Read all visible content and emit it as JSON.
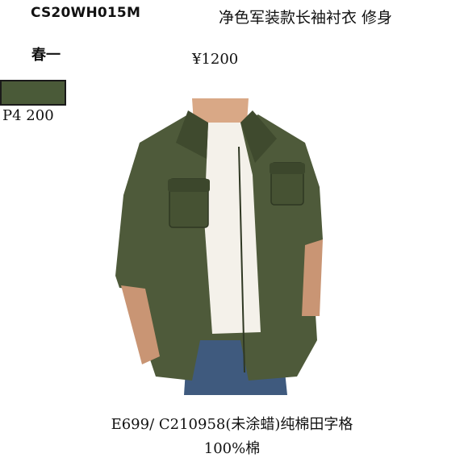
{
  "product": {
    "code": "CS20WH015M",
    "title": "净色军装款长袖衬衣 修身",
    "season": "春一",
    "price": "¥1200"
  },
  "swatch": {
    "color": "#4a5a38",
    "label": "P4 200"
  },
  "photo": {
    "subject": "olive-green-military-shirt",
    "shirt_color": "#4e5a3a",
    "tee_color": "#f4f1ea",
    "jeans_color": "#3f5a7e"
  },
  "footer": {
    "fabric": "E699/ C210958(未涂蜡)纯棉田字格",
    "composition": "100%棉"
  }
}
